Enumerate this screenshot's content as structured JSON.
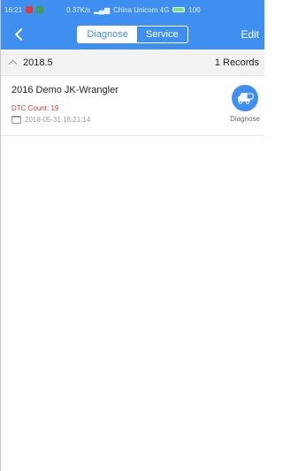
{
  "statusbar": {
    "time": "16:21",
    "speed": "0.37K/s",
    "carrier": "China Unicom 4G",
    "battery": "100"
  },
  "navbar": {
    "tabs": [
      {
        "label": "Diagnose",
        "active": true
      },
      {
        "label": "Service",
        "active": false
      }
    ],
    "edit_label": "Edit"
  },
  "group": {
    "label": "2018.5",
    "count": "1 Records"
  },
  "records": [
    {
      "title": "2016 Demo JK-Wrangler",
      "dtc": "DTC Count: 19",
      "time": "2018-05-31 16:21:14",
      "action_label": "Diagnose",
      "action_icon": "car-diagnose-icon"
    }
  ],
  "colors": {
    "primary": "#3f8ff0",
    "dtc": "#e53935"
  }
}
